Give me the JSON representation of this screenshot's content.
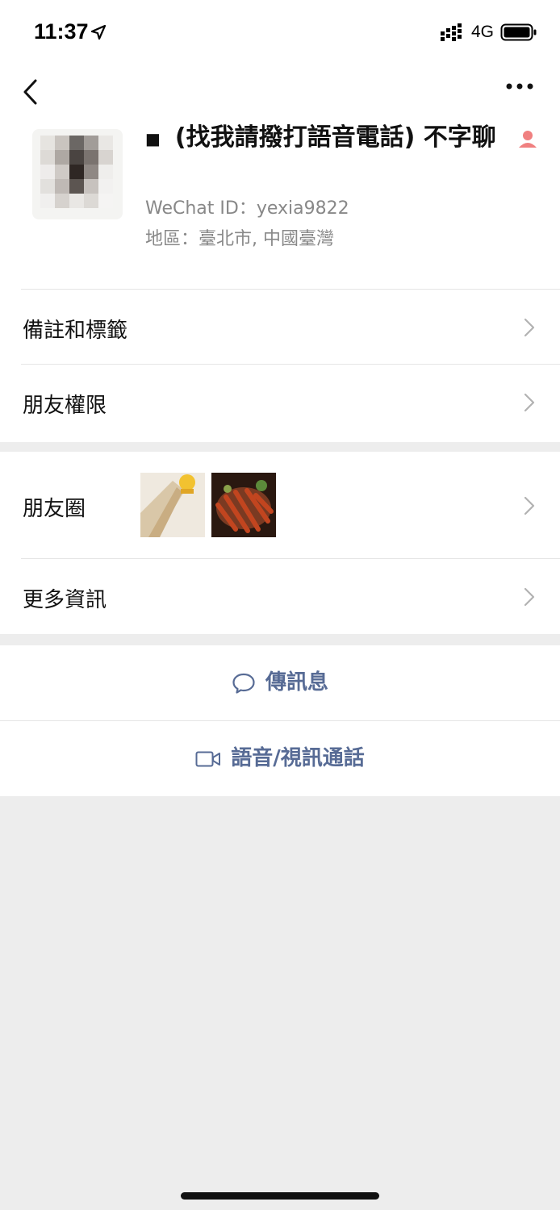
{
  "status_bar": {
    "time": "11:37",
    "network": "4G"
  },
  "profile": {
    "name": "(找我請撥打語音電話) 不字聊",
    "wechat_id": "WeChat ID：yexia9822",
    "region": "地區：臺北市, 中國臺灣"
  },
  "menu": {
    "remarks_tags": "備註和標籤",
    "friend_permissions": "朋友權限",
    "moments": "朋友圈",
    "more_info": "更多資訊"
  },
  "actions": {
    "send_message": "傳訊息",
    "voice_video_call": "語音/視訊通話"
  },
  "colors": {
    "link_blue": "#576b95",
    "background_gray": "#ededed"
  },
  "icons": [
    "location-arrow-icon",
    "signal-icon",
    "battery-icon",
    "back-icon",
    "more-icon",
    "person-icon",
    "chevron-right-icon",
    "chat-bubble-icon",
    "video-camera-icon"
  ]
}
